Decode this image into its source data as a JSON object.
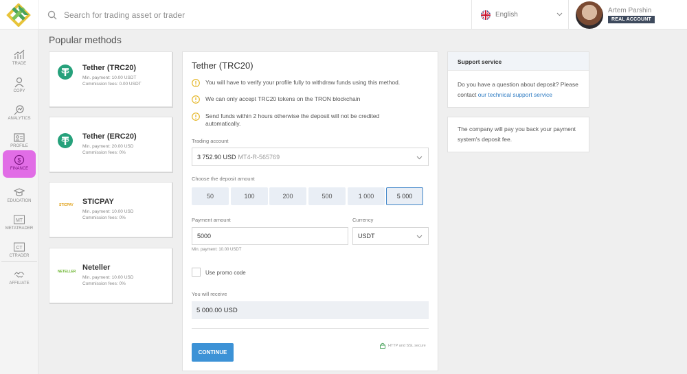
{
  "header": {
    "search_placeholder": "Search for trading asset or trader",
    "language": "English",
    "user_name": "Artem Parshin",
    "account_type": "REAL ACCOUNT"
  },
  "sidebar": {
    "items": [
      {
        "label": "TRADE",
        "icon": "trade-icon"
      },
      {
        "label": "COPY",
        "icon": "copy-icon"
      },
      {
        "label": "ANALYTICS",
        "icon": "analytics-icon"
      },
      {
        "label": "PROFILE",
        "icon": "profile-icon"
      },
      {
        "label": "FINANCE",
        "icon": "finance-icon",
        "active": true
      },
      {
        "label": "EDUCATION",
        "icon": "education-icon"
      },
      {
        "label": "METATRADER",
        "icon": "metatrader-icon"
      },
      {
        "label": "CTRADER",
        "icon": "ctrader-icon"
      },
      {
        "label": "AFFILIATE",
        "icon": "affiliate-icon"
      }
    ],
    "icon_glyphs": {
      "metatrader": "MT",
      "ctrader": "CT"
    }
  },
  "page_title": "Popular methods",
  "methods": [
    {
      "name": "Tether (TRC20)",
      "min_payment": "Min. payment: 10.00 USDT",
      "fees": "Commission fees: 0.00 USDT",
      "logo": "tether-icon"
    },
    {
      "name": "Tether (ERC20)",
      "min_payment": "Min. payment: 20.00 USD",
      "fees": "Commission fees: 0%",
      "logo": "tether-icon"
    },
    {
      "name": "STICPAY",
      "min_payment": "Min. payment: 10.00 USD",
      "fees": "Commission fees: 0%",
      "logo": "sticpay-logo",
      "logo_text": "STICPAY"
    },
    {
      "name": "Neteller",
      "min_payment": "Min. payment: 10.00 USD",
      "fees": "Commission fees: 0%",
      "logo": "neteller-logo",
      "logo_text": "NETELLER"
    }
  ],
  "form": {
    "title": "Tether (TRC20)",
    "warnings": [
      "You will have to verify your profile fully to withdraw funds using this method.",
      "We can only accept TRC20 tokens on the TRON blockchain",
      "Send funds within 2 hours otherwise the deposit will not be credited automatically."
    ],
    "trading_account_label": "Trading account",
    "trading_account_value": "3 752.90 USD",
    "trading_account_id": "MT4-R-565769",
    "deposit_amount_label": "Choose the deposit amount",
    "amounts": [
      "50",
      "100",
      "200",
      "500",
      "1 000",
      "5 000"
    ],
    "selected_amount": "5 000",
    "payment_amount_label": "Payment amount",
    "payment_amount_value": "5000",
    "currency_label": "Currency",
    "currency_value": "USDT",
    "min_payment_hint": "Min. payment: 10.00 USDT",
    "promo_label": "Use promo code",
    "receive_label": "You will receive",
    "receive_value": "5 000.00 USD",
    "continue_label": "CONTINUE",
    "secure_label": "HTTP and SSL secure"
  },
  "support": {
    "title": "Support service",
    "text": "Do you have a question about deposit? Please contact ",
    "link": "our technical support service"
  },
  "refund_note": "The company will pay you back your payment system's deposit fee.",
  "colors": {
    "accent": "#3c92d6",
    "finance_active": "#e16de6",
    "tether": "#26a17b",
    "badge": "#3e4a5d"
  }
}
